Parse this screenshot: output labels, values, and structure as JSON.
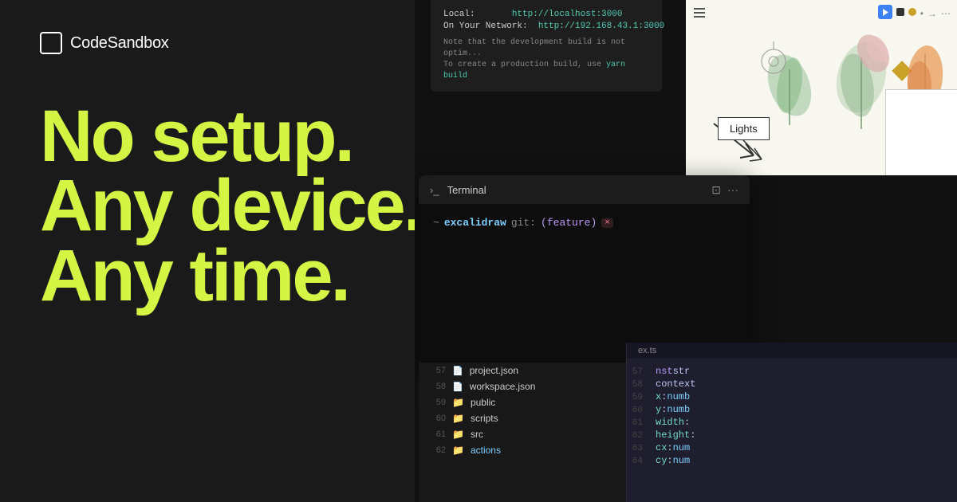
{
  "logo": {
    "text": "CodeSandbox"
  },
  "hero": {
    "line1": "No setup.",
    "line2": "Any device.",
    "line3": "Any time."
  },
  "devserver": {
    "line1_label": "Local:",
    "line1_url": "http://localhost:3000",
    "line2_label": "On Your Network:",
    "line2_url": "http://192.168.43.1:3000",
    "note1": "Note that the development build is not optim...",
    "note2": "To create a production build, use ",
    "note2_cmd": "yarn build"
  },
  "drawing_app": {
    "lights_label": "Lights"
  },
  "terminal": {
    "title": "Terminal",
    "prompt_dir": "excalidraw",
    "prompt_git_label": "git:",
    "prompt_branch": "(feature)",
    "prompt_close": "×"
  },
  "file_explorer": {
    "items": [
      {
        "line": "57",
        "type": "file",
        "name": "project.json"
      },
      {
        "line": "58",
        "type": "file",
        "name": "workspace.json"
      },
      {
        "line": "59",
        "type": "folder",
        "name": "public"
      },
      {
        "line": "60",
        "type": "folder",
        "name": "scripts"
      },
      {
        "line": "61",
        "type": "folder",
        "name": "src"
      },
      {
        "line": "62",
        "type": "folder",
        "name": "actions"
      }
    ]
  },
  "code_panel": {
    "filename": "ex.ts",
    "lines": [
      {
        "num": "57",
        "content": "nst str"
      },
      {
        "num": "58",
        "content": "context"
      },
      {
        "num": "59",
        "content": "x: numb"
      },
      {
        "num": "60",
        "content": "y: numb"
      },
      {
        "num": "61",
        "content": "width:"
      },
      {
        "num": "62",
        "content": "height:"
      },
      {
        "num": "63",
        "content": "cx: num"
      },
      {
        "num": "64",
        "content": "cy: num"
      }
    ]
  },
  "colors": {
    "accent_green": "#d4f544",
    "bg_dark": "#1a1a1a",
    "terminal_bg": "#0d0d0d"
  }
}
